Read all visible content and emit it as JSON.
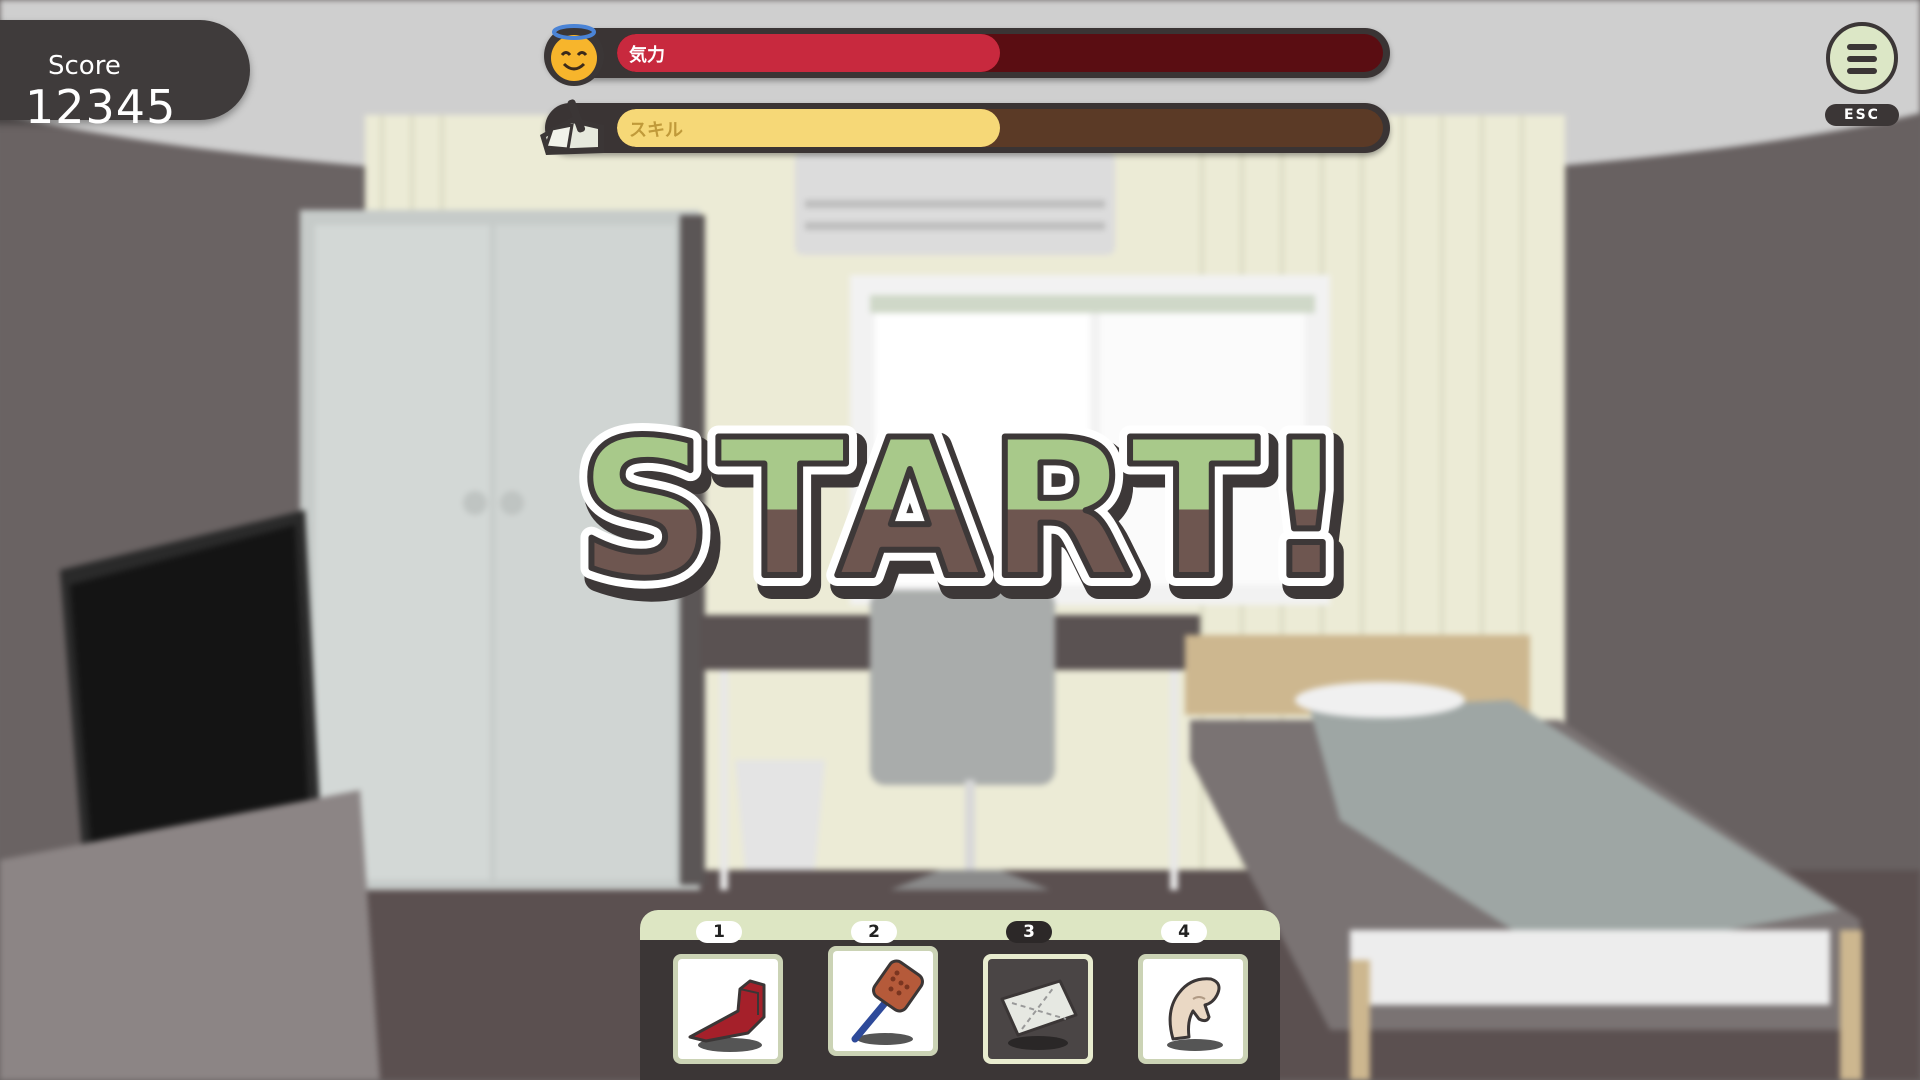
{
  "hud": {
    "score_label": "Score",
    "score_value": "12345",
    "stamina_label": "気力",
    "stamina_level": 0.5,
    "stamina_color": "#c8293e",
    "skill_label": "スキル",
    "skill_level": 0.5,
    "skill_color": "#f6d877",
    "stamina_icon": "smiling-angel-face-icon",
    "skill_icon": "broom-dustpan-icon",
    "menu_icon": "hamburger-menu-icon",
    "menu_key_hint": "ESC"
  },
  "overlay": {
    "start_text": "START!",
    "start_colors": {
      "light": "#a8c98a",
      "dark": "#6e5650",
      "outline": "#3d3838"
    }
  },
  "toolbar": {
    "selected_index": 2,
    "slots": [
      {
        "number": "1",
        "icon": "handheld-vacuum-icon"
      },
      {
        "number": "2",
        "icon": "fly-swatter-icon"
      },
      {
        "number": "3",
        "icon": "tissue-paper-icon"
      },
      {
        "number": "4",
        "icon": "bare-hand-icon"
      }
    ]
  }
}
